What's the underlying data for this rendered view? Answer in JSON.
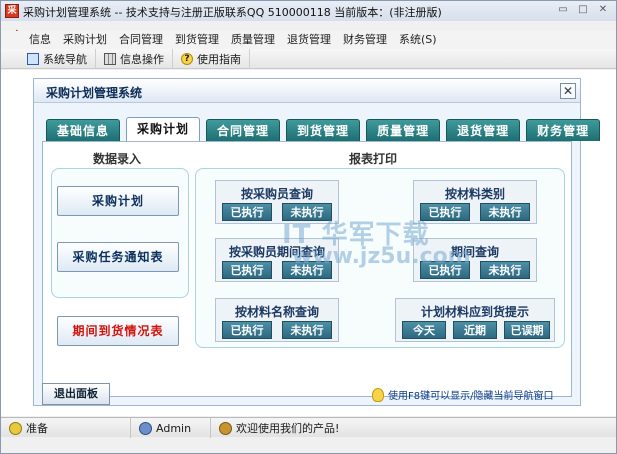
{
  "window": {
    "title": "采购计划管理系统 -- 技术支持与注册正版联系QQ 510000118    当前版本：(非注册版)",
    "minimize_glyph": "▭",
    "maximize_glyph": "□",
    "close_glyph": "✕"
  },
  "menu": {
    "items": [
      "信息",
      "采购计划",
      "合同管理",
      "到货管理",
      "质量管理",
      "退货管理",
      "财务管理",
      "系统(S)"
    ]
  },
  "toolbar": {
    "items": [
      "系统导航",
      "信息操作",
      "使用指南"
    ],
    "help_glyph": "?"
  },
  "panel": {
    "title": "采购计划管理系统",
    "close_glyph": "✕"
  },
  "tabs": {
    "items": [
      "基础信息",
      "采购计划",
      "合同管理",
      "到货管理",
      "质量管理",
      "退货管理",
      "财务管理"
    ],
    "active_index": 1
  },
  "data_entry": {
    "title": "数据录入",
    "purchase_plan_btn": "采购计划",
    "task_notice_btn": "采购任务通知表",
    "arrival_report_btn": "期间到货情况表"
  },
  "reports": {
    "title": "报表打印",
    "by_buyer": {
      "title": "按采购员查询",
      "done": "已执行",
      "pending": "未执行"
    },
    "by_category": {
      "title": "按材料类别",
      "done": "已执行",
      "pending": "未执行"
    },
    "by_buyer_period": {
      "title": "按采购员期间查询",
      "done": "已执行",
      "pending": "未执行"
    },
    "by_period": {
      "title": "期间查询",
      "done": "已执行",
      "pending": "未执行"
    },
    "by_material_name": {
      "title": "按材料名称查询",
      "done": "已执行",
      "pending": "未执行"
    },
    "arrival_reminder": {
      "title": "计划材料应到货提示",
      "today": "今天",
      "recent": "近期",
      "overdue": "已误期"
    }
  },
  "watermark": {
    "line1": "IT 华军下载",
    "line2": "www.jz5u.com"
  },
  "exit_btn": "退出面板",
  "hint": "使用F8键可以显示/隐藏当前导航窗口",
  "status": {
    "ready": "准备",
    "user": "Admin",
    "welcome": "欢迎使用我们的产品!"
  },
  "colors": {
    "tab_bg": "#2e8587",
    "report_btn": "#3b7f96",
    "red_text": "#d3140c",
    "panel_bg": "#eef4fb"
  }
}
